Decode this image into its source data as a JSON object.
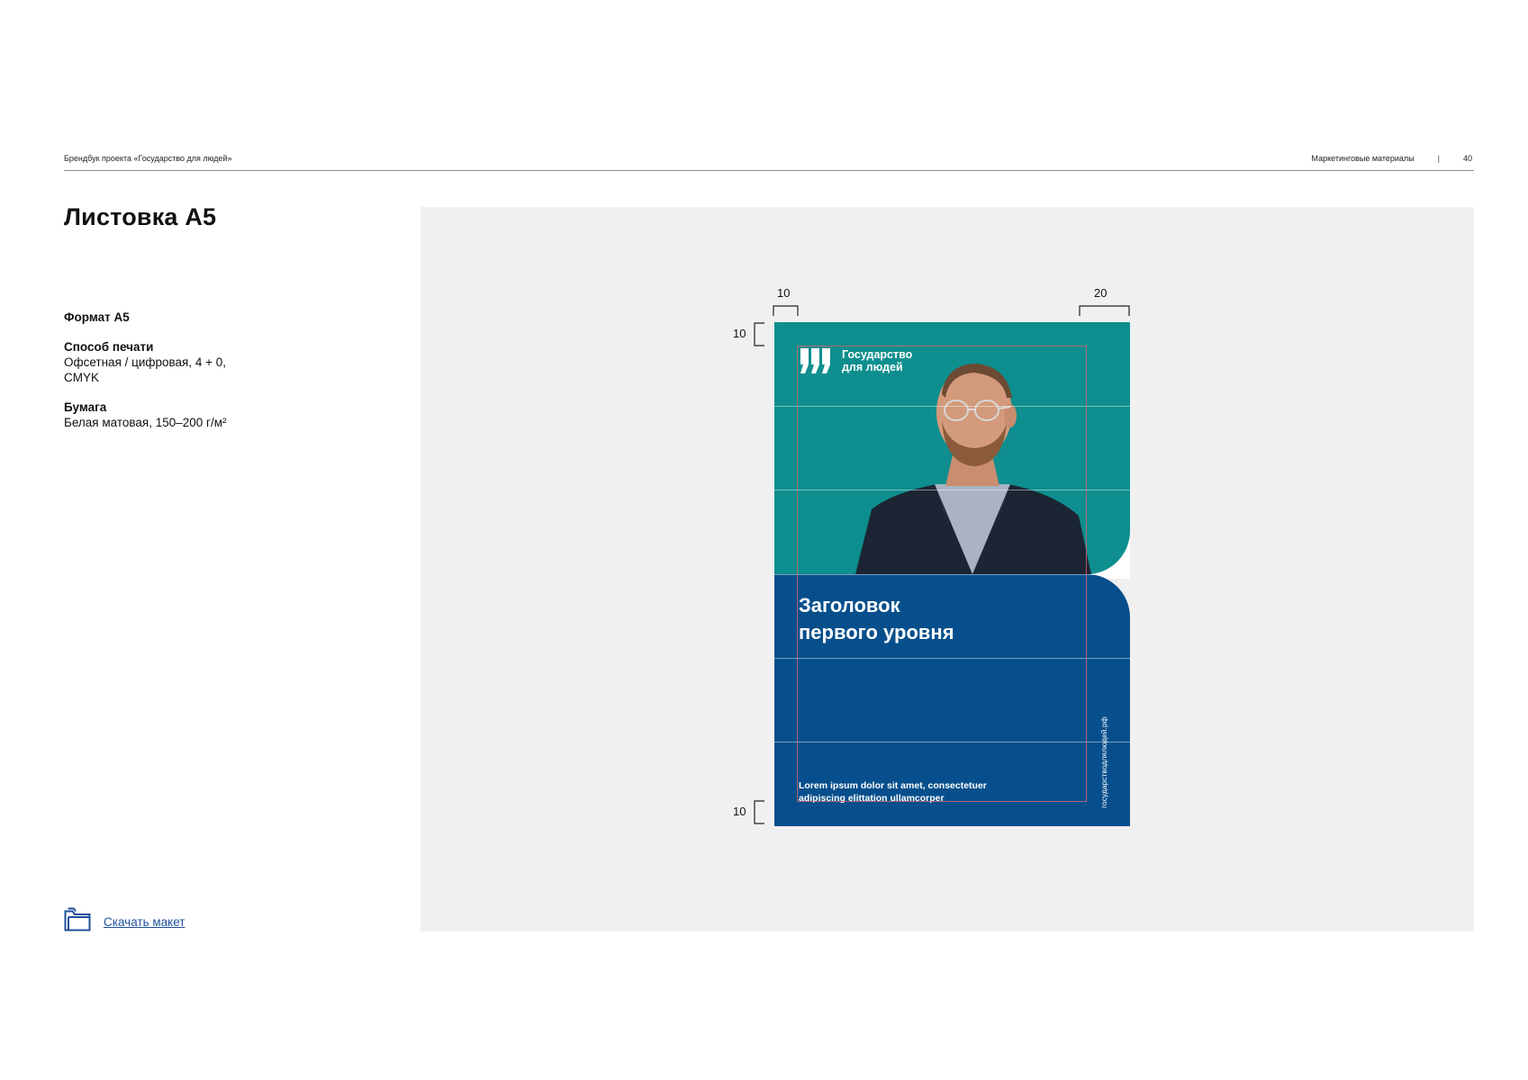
{
  "header": {
    "left_text": "Брендбук проекта «Государство для людей»",
    "section": "Маркетинговые материалы",
    "separator": "|",
    "page_number": "40"
  },
  "title": "Листовка А5",
  "specs": {
    "format_label": "Формат А5",
    "print_label": "Способ печати",
    "print_value_1": "Офсетная / цифровая, 4 + 0,",
    "print_value_2": "CMYK",
    "paper_label": "Бумага",
    "paper_value": "Белая матовая, 150–200 г/м²"
  },
  "download": {
    "label": "Скачать макет",
    "icon": "folder-icon"
  },
  "dimensions": {
    "left_margin": "10",
    "right_margin": "20",
    "top_margin": "10",
    "bottom_margin": "10"
  },
  "flyer": {
    "logo_line_1": "Государство",
    "logo_line_2": "для людей",
    "headline_line_1": "Заголовок",
    "headline_line_2": "первого уровня",
    "body_line_1": "Lorem ipsum dolor sit amet, consectetuer",
    "body_line_2": "adipiscing elittation ullamcorper",
    "url": "государстводлялюдей.рф"
  },
  "colors": {
    "teal": "#0e8e8e",
    "blue": "#064f8c",
    "preview_bg": "#f0f0f0",
    "link": "#1f4f9a"
  }
}
